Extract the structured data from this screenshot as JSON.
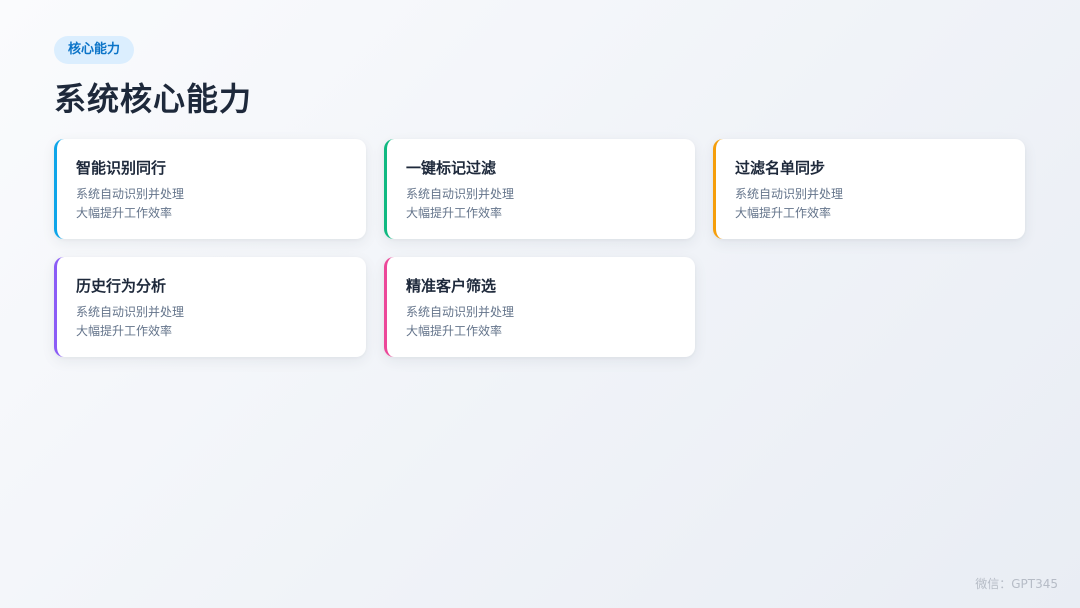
{
  "header": {
    "badge": "核心能力",
    "title": "系统核心能力"
  },
  "cards": [
    {
      "title": "智能识别同行",
      "line1": "系统自动识别并处理",
      "line2": "大幅提升工作效率",
      "accent": "#0ea5e9"
    },
    {
      "title": "一键标记过滤",
      "line1": "系统自动识别并处理",
      "line2": "大幅提升工作效率",
      "accent": "#10b981"
    },
    {
      "title": "过滤名单同步",
      "line1": "系统自动识别并处理",
      "line2": "大幅提升工作效率",
      "accent": "#f59e0b"
    },
    {
      "title": "历史行为分析",
      "line1": "系统自动识别并处理",
      "line2": "大幅提升工作效率",
      "accent": "#8b5cf6"
    },
    {
      "title": "精准客户筛选",
      "line1": "系统自动识别并处理",
      "line2": "大幅提升工作效率",
      "accent": "#ec4899"
    }
  ],
  "footer": {
    "watermark": "微信：GPT345"
  }
}
